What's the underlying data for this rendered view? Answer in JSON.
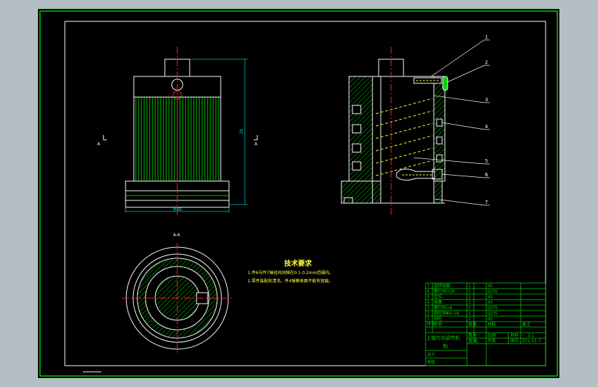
{
  "colors": {
    "background": "#b3bfc5",
    "sheet": "#000000",
    "frame": "#00d400",
    "outline": "#ffffff",
    "hatch": "#00c800",
    "centerline": "#ff2020",
    "thread": "#ffff40",
    "dimension": "#00c8c8"
  },
  "views": {
    "front": {
      "dim_height": "28",
      "dim_width": "Φ48",
      "section_label_left": "A",
      "section_label_right": "A"
    },
    "section_ab": {
      "label": "A-A"
    }
  },
  "balloons": [
    "1",
    "2",
    "3",
    "4",
    "5",
    "6",
    "7"
  ],
  "tech_requirements": {
    "title": "技术要求",
    "items": [
      "1.件6与件7轴径间间隙在0.1-0.2mm范围内。",
      "2.零件装配前清洗，件4弹簧表面不能有划痕。"
    ]
  },
  "title_block": {
    "rows": [
      {
        "no": "7",
        "name": "旋转轴套",
        "qty": "1",
        "material": "45",
        "note": ""
      },
      {
        "no": "6",
        "name": "螺钉M5×18",
        "qty": "1",
        "material": "Q235",
        "note": ""
      },
      {
        "no": "5",
        "name": "定位",
        "qty": "1",
        "material": "45",
        "note": ""
      },
      {
        "no": "4",
        "name": "弹簧",
        "qty": "1",
        "material": "45",
        "note": ""
      },
      {
        "no": "3",
        "name": "螺钉M2×6",
        "qty": "2",
        "material": "Q235",
        "note": ""
      },
      {
        "no": "2",
        "name": "圆柱销Φ6×18",
        "qty": "1",
        "material": "Q235",
        "note": ""
      },
      {
        "no": "1",
        "name": "销柱",
        "qty": "1",
        "material": "45",
        "note": ""
      }
    ],
    "header": {
      "no": "序号",
      "name": "名称",
      "qty": "数量",
      "material": "材料",
      "note": "备注"
    },
    "drawing_name_line1": "上轴方向调节机",
    "drawing_name_line2": "构",
    "scale_label": "比例",
    "scale_value": "2:1",
    "sheet_label": "图号",
    "sheet_value": "ZY1-01-7",
    "qty_label": "数量",
    "qty_value": "1",
    "material_label": "材料",
    "designer_label": "设计",
    "checker_label": "审核",
    "count_label": "件数",
    "weight_label": "重量"
  }
}
